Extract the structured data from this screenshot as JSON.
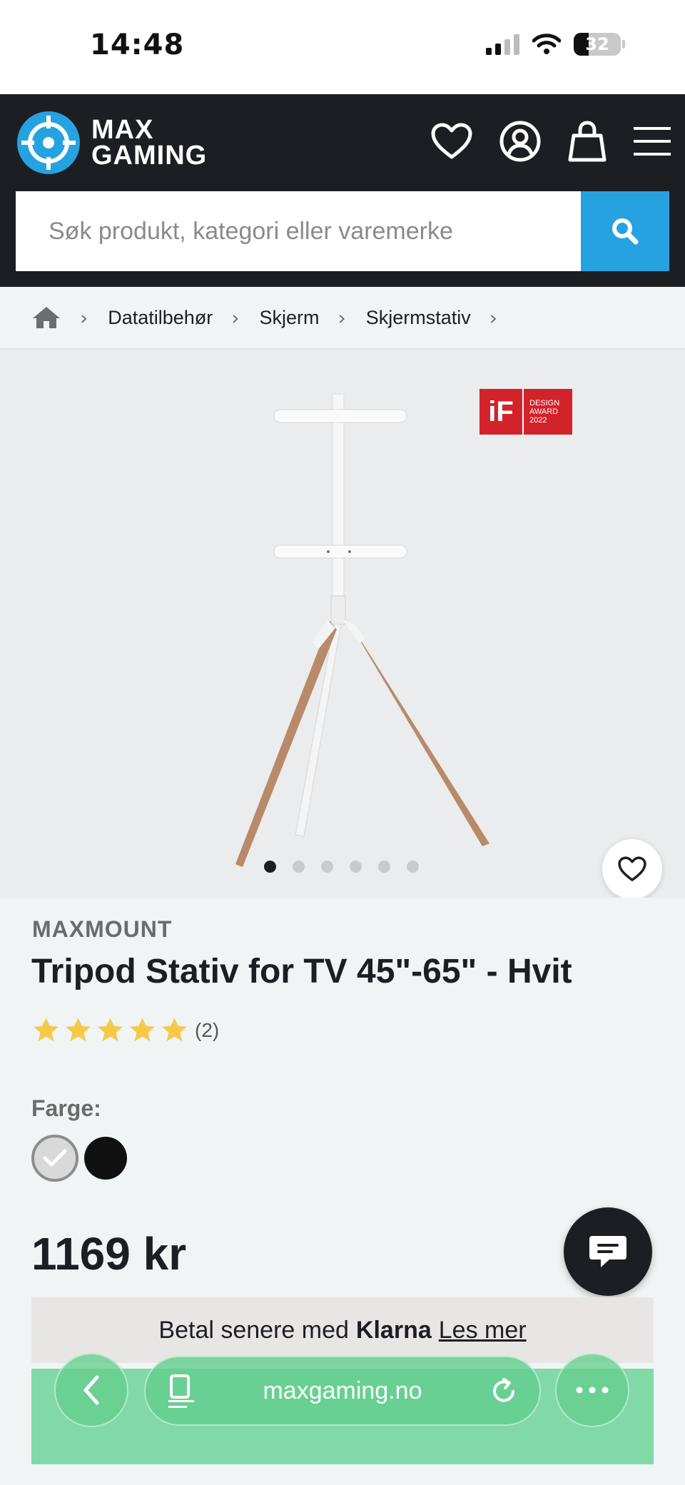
{
  "status_bar": {
    "time": "14:48",
    "battery": "32"
  },
  "header": {
    "logo_line1": "MAX",
    "logo_line2": "GAMING",
    "search_placeholder": "Søk produkt, kategori eller varemerke"
  },
  "breadcrumb": [
    "Datatilbehør",
    "Skjerm",
    "Skjermstativ"
  ],
  "product_image": {
    "badge_left": "iF",
    "badge_right_1": "DESIGN",
    "badge_right_2": "AWARD",
    "badge_right_3": "2022",
    "total_images": 6,
    "active_image": 1
  },
  "product": {
    "brand": "MAXMOUNT",
    "title": "Tripod Stativ for TV 45\"-65\" - Hvit",
    "rating_stars": 5,
    "rating_count": "(2)",
    "color_label": "Farge:",
    "colors": [
      "white",
      "black"
    ],
    "price": "1169 kr"
  },
  "klarna": {
    "prefix": "Betal senere med",
    "brand": "Klarna",
    "link": "Les mer"
  },
  "browser": {
    "url": "maxgaming.no"
  },
  "colors": {
    "header_bg": "#1d1e23",
    "accent": "#27a2e0",
    "star": "#f7c948",
    "browser_green": "#62cd8c"
  }
}
